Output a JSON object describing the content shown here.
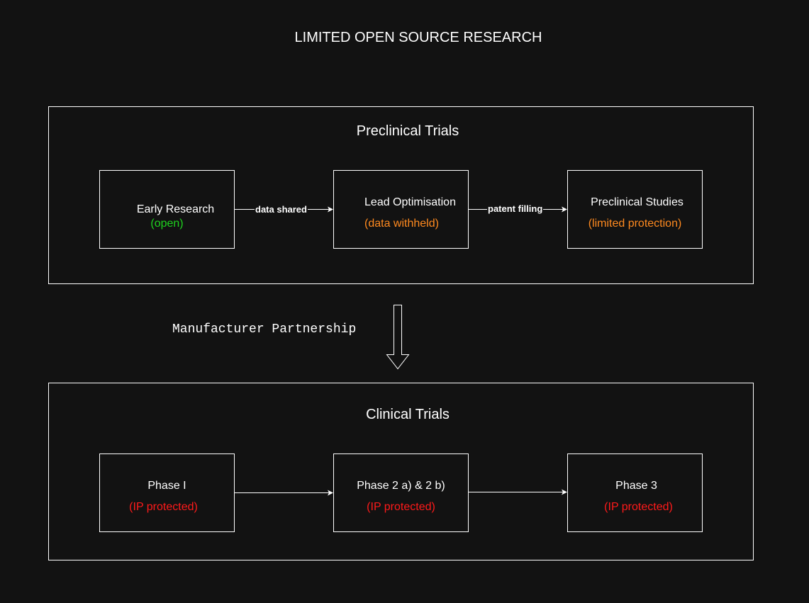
{
  "title": "LIMITED OPEN SOURCE RESEARCH",
  "preclinical": {
    "label": "Preclinical Trials",
    "nodes": [
      {
        "title": "Early Research",
        "status": "(open)",
        "status_color": "#1ed21e"
      },
      {
        "title": "Lead Optimisation",
        "status": "(data withheld)",
        "status_color": "#ff8a1f"
      },
      {
        "title": "Preclinical Studies",
        "status": "(limited protection)",
        "status_color": "#ff8a1f"
      }
    ],
    "edges": [
      {
        "label": "data shared"
      },
      {
        "label": "patent filling"
      }
    ]
  },
  "transition": {
    "label": "Manufacturer Partnership"
  },
  "clinical": {
    "label": "Clinical Trials",
    "nodes": [
      {
        "title": "Phase I",
        "status": "(IP protected)",
        "status_color": "#ff1a1a"
      },
      {
        "title": "Phase 2 a) & 2 b)",
        "status": "(IP protected)",
        "status_color": "#ff1a1a"
      },
      {
        "title": "Phase 3",
        "status": "(IP protected)",
        "status_color": "#ff1a1a"
      }
    ]
  }
}
